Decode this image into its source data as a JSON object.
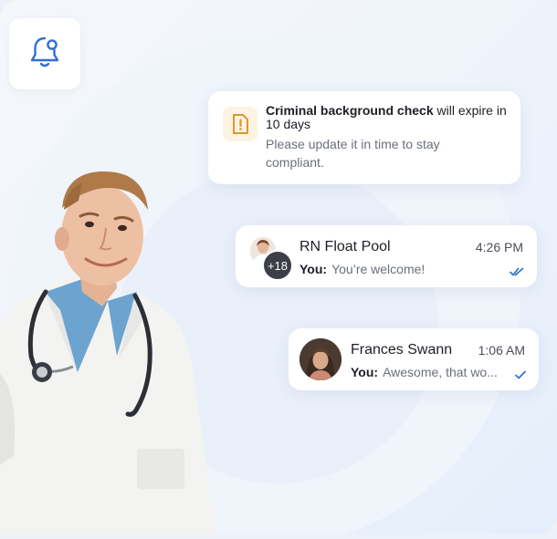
{
  "alert": {
    "title_bold": "Criminal background check",
    "title_rest": " will expire in 10 days",
    "description": "Please update it in time to stay compliant.",
    "icon": "document-warning-icon"
  },
  "notification_tile": {
    "icon": "bell-icon"
  },
  "chats": [
    {
      "name": "RN Float Pool",
      "time": "4:26 PM",
      "sender": "You:",
      "message": "You’re welcome!",
      "badge": "+18",
      "status_icon": "double-check-icon"
    },
    {
      "name": "Frances Swann",
      "time": "1:06 AM",
      "sender": "You:",
      "message": "Awesome, that wo...",
      "status_icon": "check-icon"
    }
  ],
  "colors": {
    "accent_blue": "#2f6fd6",
    "warning": "#d99a2b",
    "background": "#eef3fb"
  }
}
